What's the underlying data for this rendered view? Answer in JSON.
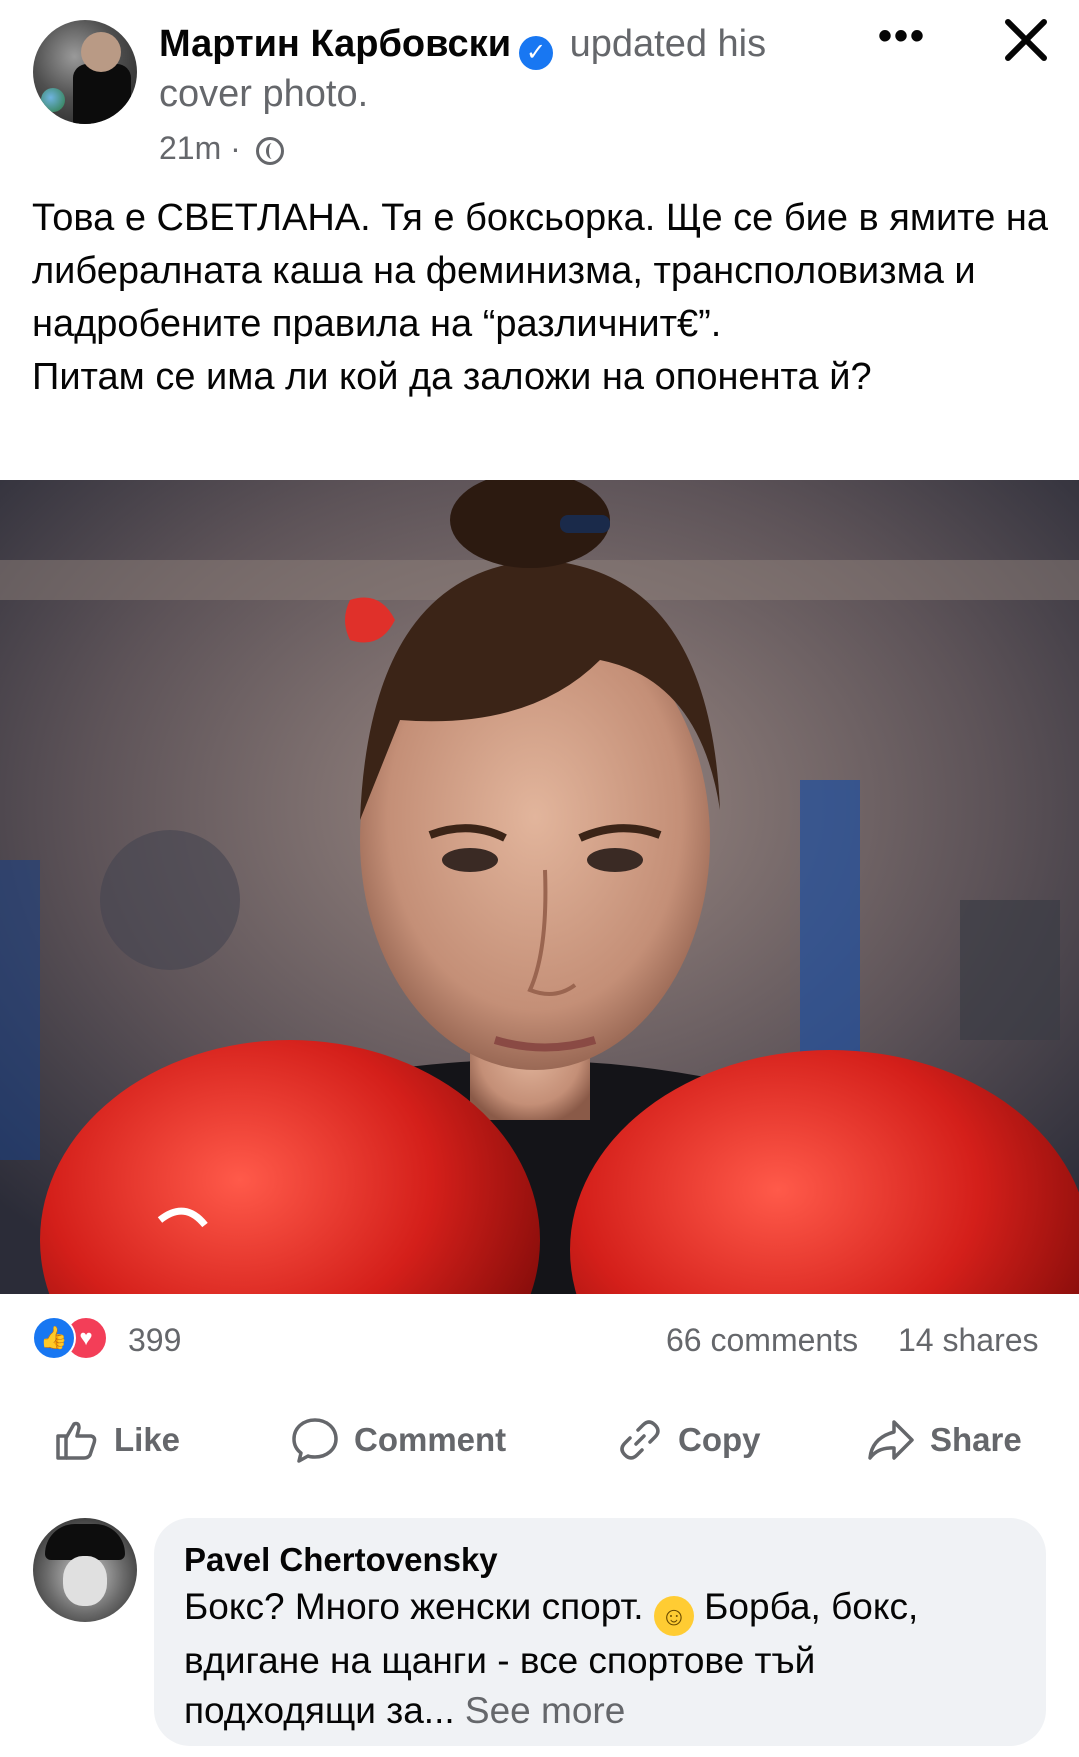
{
  "post": {
    "author": "Мартин Карбовски",
    "action_text": " updated his cover photo.",
    "verified_icon": "verified-check-icon",
    "timestamp": "21m",
    "separator": "·",
    "audience_icon": "globe-icon",
    "more_label": "•••",
    "close_label": "✕",
    "text_lines": [
      "Това е СВЕТЛАНА. Тя е боксьорка. Ще се бие в ямите на либералната каша на феминизма, трансполовизма и надробените правила на “различнит€”.",
      "Питам се има ли кой да заложи на опонента й?"
    ]
  },
  "stats": {
    "reaction_count": "399",
    "comments": "66 comments",
    "shares": "14 shares",
    "reaction_icons": [
      "like-reaction-icon",
      "love-reaction-icon"
    ]
  },
  "actions": {
    "like": "Like",
    "comment": "Comment",
    "copy": "Copy",
    "share": "Share"
  },
  "comment": {
    "author": "Pavel Chertovensky",
    "text_before": "Бокс? Много женски спорт. ",
    "text_after": " Борба, бокс, вдигане на щанги - все спортове тъй подходящи за...",
    "see_more": " See more",
    "emoji": "☺"
  },
  "colors": {
    "brand_blue": "#1877f2",
    "love_red": "#f33e58",
    "secondary_text": "#65676b",
    "bubble_bg": "#f0f2f5"
  }
}
